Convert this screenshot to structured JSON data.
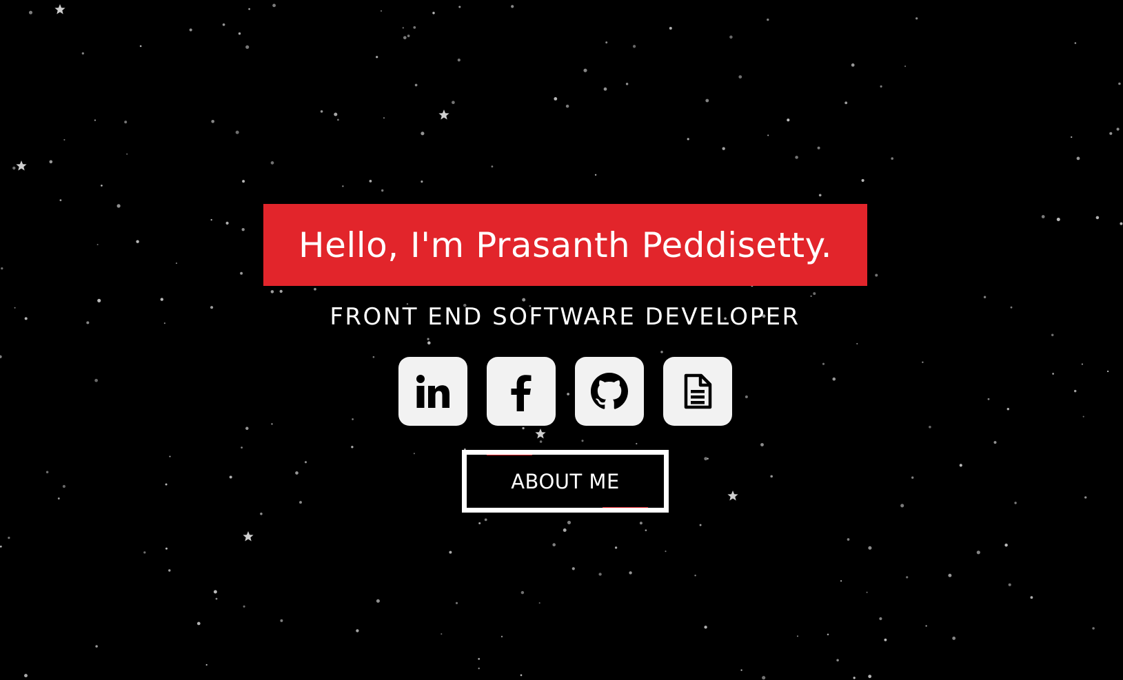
{
  "hero": {
    "title": "Hello, I'm Prasanth Peddisetty.",
    "subtitle": "FRONT END SOFTWARE DEVELOPER",
    "about_button_label": "ABOUT ME"
  },
  "social_links": [
    {
      "icon": "linkedin-icon"
    },
    {
      "icon": "facebook-icon"
    },
    {
      "icon": "github-icon"
    },
    {
      "icon": "resume-document-icon"
    }
  ],
  "colors": {
    "background": "#000000",
    "accent": "#e2252b",
    "button_face": "#f2f2f2",
    "text": "#ffffff"
  }
}
